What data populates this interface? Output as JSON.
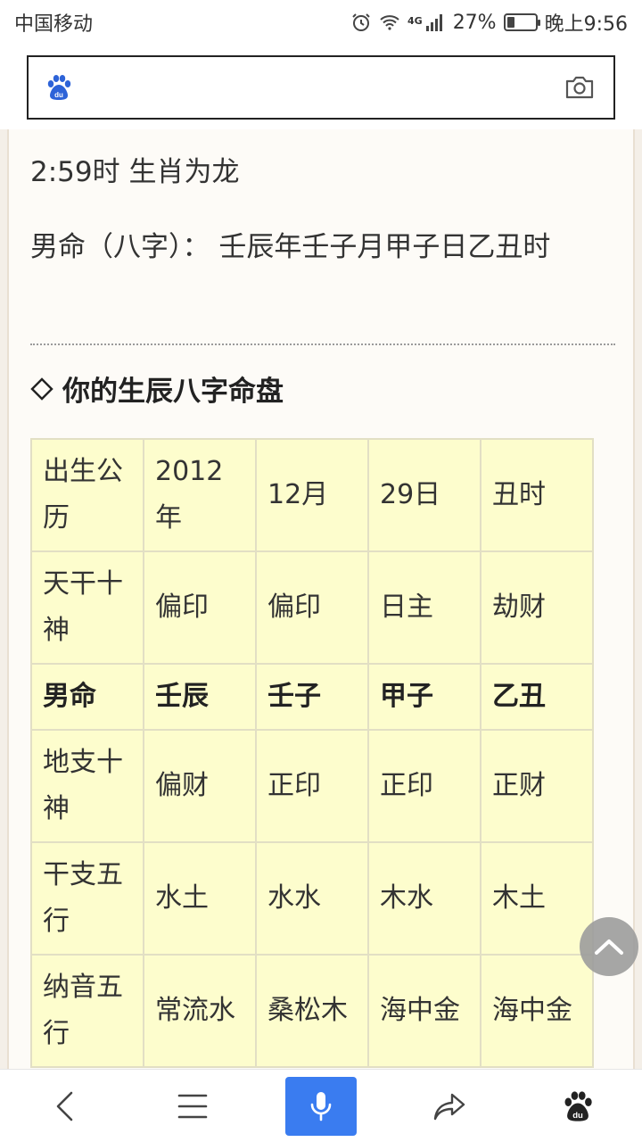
{
  "status": {
    "carrier": "中国移动",
    "network": "4G",
    "battery": "27%",
    "battery_level": 0.27,
    "time": "晚上9:56"
  },
  "search": {
    "value": "",
    "placeholder": ""
  },
  "article": {
    "line1": "2:59时 生肖为龙",
    "line2": "男命（八字）： 壬辰年壬子月甲子日乙丑时",
    "section_title": "你的生辰八字命盘"
  },
  "table": {
    "rows": [
      [
        "出生公历",
        "2012年",
        "12月",
        "29日",
        "丑时"
      ],
      [
        "天干十神",
        "偏印",
        "偏印",
        "日主",
        "劫财"
      ],
      [
        "男命",
        "壬辰",
        "壬子",
        "甲子",
        "乙丑"
      ],
      [
        "地支十神",
        "偏财",
        "正印",
        "正印",
        "正财"
      ],
      [
        "干支五行",
        "水土",
        "水水",
        "木水",
        "木土"
      ],
      [
        "纳音五行",
        "常流水",
        "桑松木",
        "海中金",
        "海中金"
      ]
    ]
  },
  "colors": {
    "accent": "#3a7cf0",
    "table_bg": "#fdfdcd",
    "table_border": "#e2dfc4",
    "page_bg": "#f4efe8"
  },
  "icons": {
    "alarm": "alarm-icon",
    "wifi": "wifi-icon",
    "signal": "signal-icon",
    "baidu": "baidu-paw-icon",
    "camera": "camera-icon",
    "back": "back-icon",
    "menu": "menu-icon",
    "mic": "mic-icon",
    "share": "share-icon",
    "scroll_top": "chevron-up-icon"
  }
}
